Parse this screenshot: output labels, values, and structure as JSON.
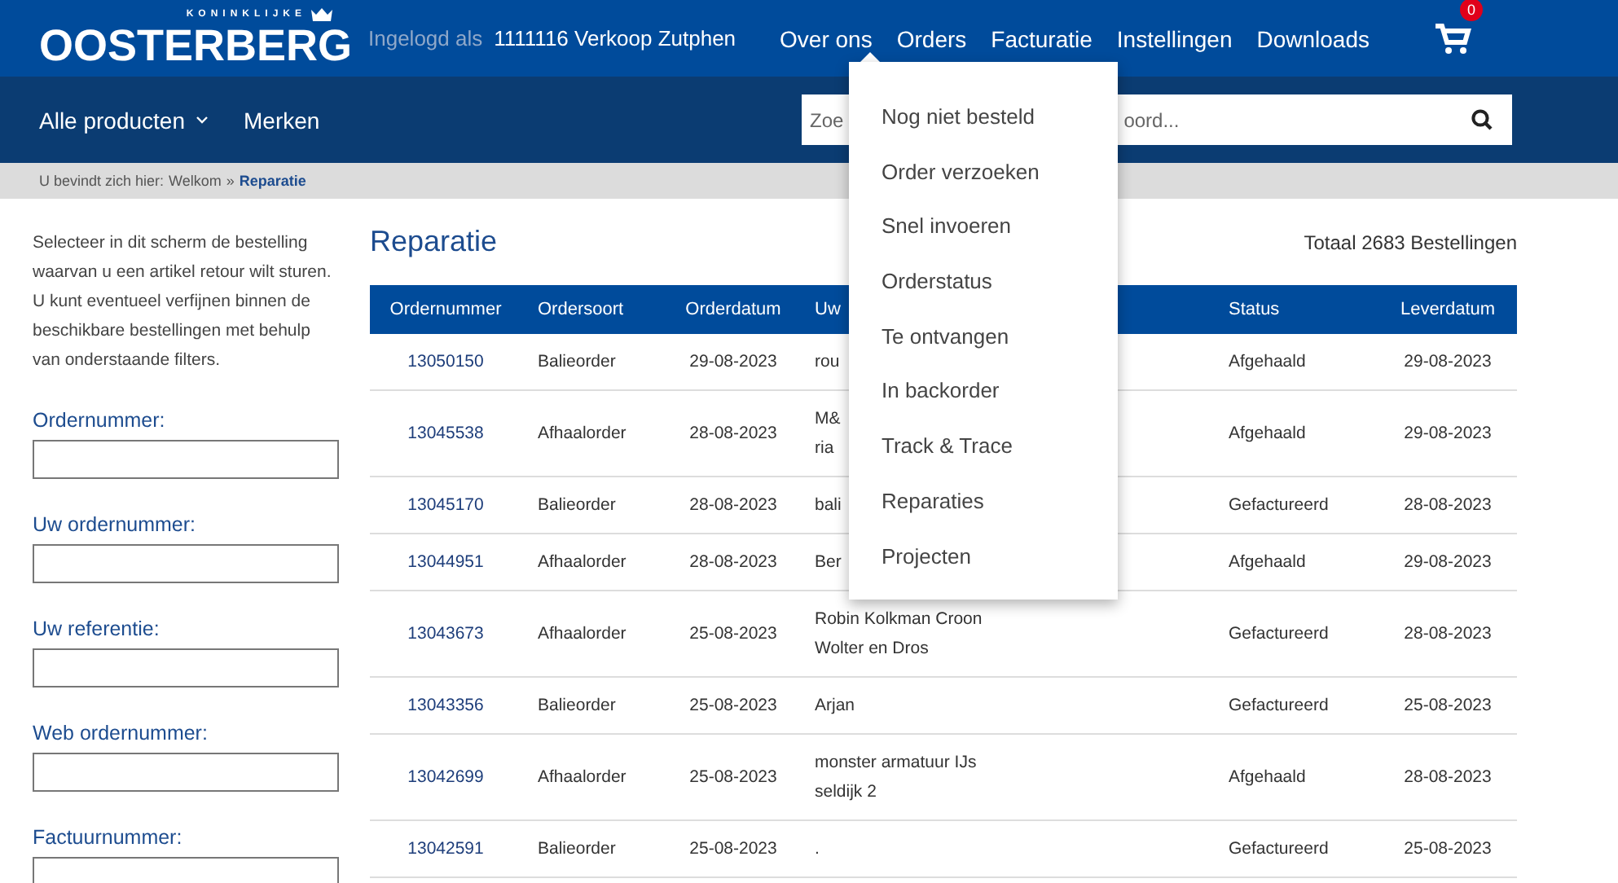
{
  "header": {
    "logo": {
      "tagline": "KONINKLIJKE",
      "name": "OOSTERBERG"
    },
    "login": {
      "label": "Ingelogd als",
      "user": "1111116 Verkoop Zutphen"
    },
    "nav": [
      {
        "label": "Over ons"
      },
      {
        "label": "Orders"
      },
      {
        "label": "Facturatie"
      },
      {
        "label": "Instellingen"
      },
      {
        "label": "Downloads"
      }
    ],
    "cart": {
      "count": "0"
    }
  },
  "subnav": {
    "items": [
      {
        "label": "Alle producten",
        "kind": "dropdown"
      },
      {
        "label": "Merken",
        "kind": "link"
      }
    ],
    "search": {
      "placeholder": "Zoe",
      "placeholder_tail": "oord..."
    }
  },
  "breadcrumb": {
    "prefix": "U bevindt zich hier:",
    "items": [
      {
        "label": "Welkom",
        "selected": false
      },
      {
        "label": "Reparatie",
        "selected": true
      }
    ],
    "separator": "»"
  },
  "sidebar": {
    "intro": [
      "Selecteer in dit scherm de bestelling waarvan u een artikel retour wilt sturen.",
      "U kunt eventueel verfijnen binnen de beschikbare bestellingen met behulp van onderstaande filters."
    ],
    "filters": [
      {
        "label": "Ordernummer:"
      },
      {
        "label": "Uw ordernummer:"
      },
      {
        "label": "Uw referentie:"
      },
      {
        "label": "Web ordernummer:"
      },
      {
        "label": "Factuurnummer:"
      }
    ]
  },
  "main": {
    "title": "Reparatie",
    "total": "Totaal 2683 Bestellingen",
    "table": {
      "columns": [
        "Ordernummer",
        "Ordersoort",
        "Orderdatum",
        "Uw",
        "Status",
        "Leverdatum"
      ],
      "rows": [
        {
          "cells": [
            "13050150",
            "Balieorder",
            "29-08-2023",
            "rou",
            "Afgehaald",
            "29-08-2023"
          ]
        },
        {
          "cells": [
            "13045538",
            "Afhaalorder",
            "28-08-2023",
            "M&\nria",
            "Afgehaald",
            "29-08-2023"
          ]
        },
        {
          "cells": [
            "13045170",
            "Balieorder",
            "28-08-2023",
            "bali",
            "Gefactureerd",
            "28-08-2023"
          ]
        },
        {
          "cells": [
            "13044951",
            "Afhaalorder",
            "28-08-2023",
            "Ber",
            "Afgehaald",
            "29-08-2023"
          ]
        },
        {
          "cells": [
            "13043673",
            "Afhaalorder",
            "25-08-2023",
            "Robin Kolkman Croon\nWolter en Dros",
            "Gefactureerd",
            "28-08-2023"
          ]
        },
        {
          "cells": [
            "13043356",
            "Balieorder",
            "25-08-2023",
            "Arjan",
            "Gefactureerd",
            "25-08-2023"
          ]
        },
        {
          "cells": [
            "13042699",
            "Afhaalorder",
            "25-08-2023",
            "monster armatuur IJs\nseldijk 2",
            "Afgehaald",
            "28-08-2023"
          ]
        },
        {
          "cells": [
            "13042591",
            "Balieorder",
            "25-08-2023",
            ".",
            "Gefactureerd",
            "25-08-2023"
          ]
        }
      ]
    }
  },
  "orders_menu": {
    "items": [
      "Nog niet besteld",
      "Order verzoeken",
      "Snel invoeren",
      "Orderstatus",
      "Te ontvangen",
      "In backorder",
      "Track & Trace",
      "Reparaties",
      "Projecten"
    ]
  }
}
